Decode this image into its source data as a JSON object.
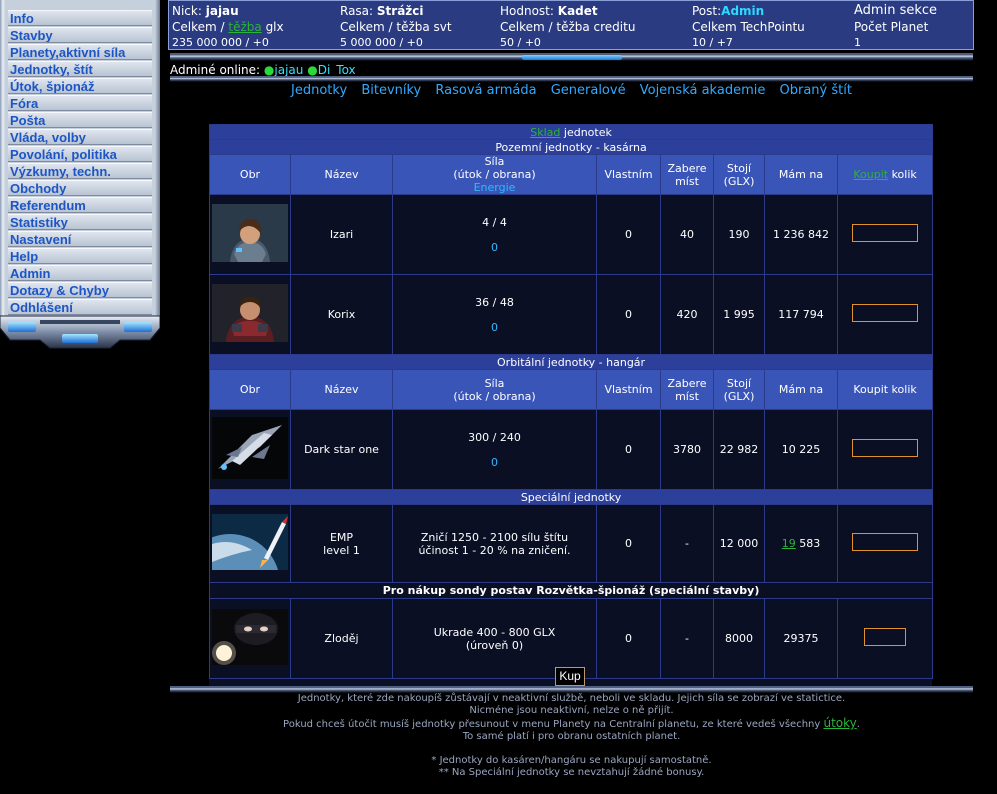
{
  "sidebar": {
    "items": [
      {
        "label": "Info"
      },
      {
        "label": "Stavby"
      },
      {
        "label": "Planety,aktivní síla"
      },
      {
        "label": "Jednotky, štít"
      },
      {
        "label": "Útok, špionáž"
      },
      {
        "label": "Fóra"
      },
      {
        "label": "Pošta"
      },
      {
        "label": "Vláda, volby"
      },
      {
        "label": "Povolání, politika"
      },
      {
        "label": "Výzkumy, techn."
      },
      {
        "label": "Obchody"
      },
      {
        "label": "Referendum"
      },
      {
        "label": "Statistiky"
      },
      {
        "label": "Nastavení"
      },
      {
        "label": "Help"
      },
      {
        "label": "Admin"
      },
      {
        "label": "Dotazy & Chyby"
      },
      {
        "label": "Odhlášení"
      }
    ]
  },
  "header": {
    "nick_label": "Nick:",
    "nick": "jajau",
    "rasa_label": "Rasa:",
    "rasa": "Strážci",
    "hodnost_label": "Hodnost:",
    "hodnost": "Kadet",
    "post_label": "Post:",
    "post": "Admin",
    "admin_section": "Admin sekce",
    "glx_label_a": "Celkem /",
    "glx_label_link": "těžba",
    "glx_label_b": "glx",
    "glx_value": "235 000 000 / +0",
    "svt_label": "Celkem / těžba svt",
    "svt_value": "5 000 000 / +0",
    "credit_label": "Celkem / těžba creditu",
    "credit_value": "50 / +0",
    "techpoint_label": "Celkem TechPointu",
    "techpoint_value": "10 / +7",
    "planets_label": "Počet Planet",
    "planets_value": "1"
  },
  "online": {
    "label": "Adminé online:",
    "users": [
      "jajau",
      "Di_Tox"
    ]
  },
  "subnav": [
    "Jednotky",
    "Bitevníky",
    "Rasová armáda",
    "Generalové",
    "Vojenská akademie",
    "Obraný štít"
  ],
  "warehouse": {
    "title_link": "Sklad",
    "title_rest": "jednotek"
  },
  "sections": {
    "ground": "Pozemní jednotky - kasárna",
    "orbital": "Orbitální jednotky - hangár",
    "special": "Speciální jednotky",
    "spy_banner": "Pro nákup sondy postav Rozvětka-špionáž (speciální stavby)"
  },
  "columns": {
    "image": "Obr",
    "name": "Název",
    "power_a": "Síla",
    "power_b": "(útok / obrana)",
    "energy": "Energie",
    "owned": "Vlastním",
    "space_a": "Zabere",
    "space_b": "míst",
    "cost_a": "Stojí",
    "cost_b": "(GLX)",
    "have": "Mám na",
    "buy_link": "Koupit",
    "buy_rest": "kolik",
    "buy_plain": "Koupit kolik"
  },
  "ground_units": [
    {
      "name": "Izari",
      "power": "4 / 4",
      "energy": "0",
      "owned": "0",
      "space": "40",
      "cost": "190",
      "have": "1 236 842",
      "icon": "soldier-female-portrait"
    },
    {
      "name": "Korix",
      "power": "36 / 48",
      "energy": "0",
      "owned": "0",
      "space": "420",
      "cost": "1 995",
      "have": "117 794",
      "icon": "soldier-male-portrait"
    }
  ],
  "orbital_units": [
    {
      "name": "Dark star one",
      "power": "300 / 240",
      "energy": "0",
      "owned": "0",
      "space": "3780",
      "cost": "22 982",
      "have": "10 225",
      "icon": "starship"
    }
  ],
  "special_units": [
    {
      "name_a": "EMP",
      "name_b": "level 1",
      "desc_a": "Zničí 1250 - 2100 sílu štítu",
      "desc_b": "účinost 1 - 20 % na zničení.",
      "owned": "0",
      "space": "-",
      "cost": "12 000",
      "have_link": "19",
      "have_rest": "583",
      "icon": "rocket-over-planet"
    }
  ],
  "spy_units": [
    {
      "name": "Zloděj",
      "desc_a": "Ukrade 400 - 800 GLX",
      "desc_b": "(úroveň 0)",
      "owned": "0",
      "space": "-",
      "cost": "8000",
      "have": "29375",
      "icon": "masked-thief"
    }
  ],
  "buy_button": "Kup",
  "footer": {
    "line1": "Jednotky, které zde nakoupíš zůstávají v neaktivní službě, neboli ve skladu. Jejich síla se zobrazí ve statictice.",
    "line2": "Nicméne jsou neaktivní, nelze o ně přijít.",
    "line3a": "Pokud chceš útočit musíš jednotky přesunout v menu Planety na Centralní planetu, ze které vedeš všechny",
    "line3link": "útoky",
    "line3b": ".",
    "line4": "To samé platí i pro obranu ostatních planet.",
    "note1": "* Jednotky do kasáren/hangáru se nakupují samostatně.",
    "note2": "** Na Speciální jednotky se nevztahují žádné bonusy."
  },
  "colors": {
    "menu_text": "#1c55c4",
    "header_bg": "#2a3b82",
    "table_header": "#3a55b8",
    "section_bar": "#2c3f9a",
    "link_green": "#2bb33a",
    "energy_cyan": "#33b8ff",
    "input_border": "#e0922e"
  }
}
